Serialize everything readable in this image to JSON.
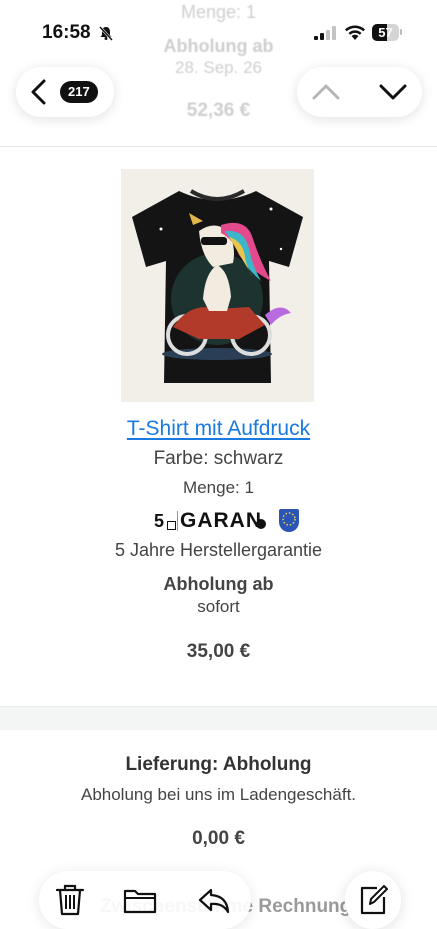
{
  "status_bar": {
    "time": "16:58",
    "battery_level": "57"
  },
  "background_scroll": {
    "qty": "Menge: 1",
    "pickup_label": "Abholung ab",
    "pickup_date": "28. Sep. 26",
    "price": "52,36 €"
  },
  "nav": {
    "message_count": "217"
  },
  "product": {
    "title": "T-Shirt mit Aufdruck",
    "color": "Farbe: schwarz",
    "quantity": "Menge: 1",
    "guarantee_logo_text": "GARAN",
    "guarantee_years": "5",
    "warranty": "5 Jahre Herstellergarantie",
    "pickup_label": "Abholung ab",
    "pickup_value": "sofort",
    "price": "35,00 €"
  },
  "delivery": {
    "title": "Lieferung: Abholung",
    "description": "Abholung bei uns im Ladengeschäft.",
    "price": "0,00 €"
  },
  "footer_peek": {
    "text": "Zwischensumme Rechnung"
  },
  "colors": {
    "link": "#1a7ae0",
    "text": "#333333"
  }
}
